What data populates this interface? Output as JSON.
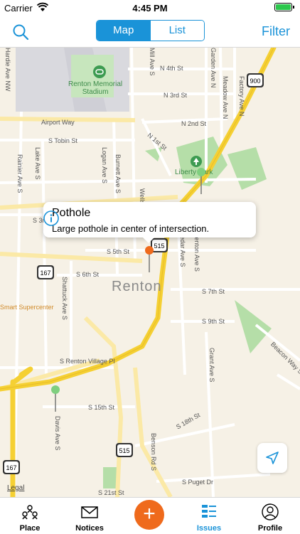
{
  "status_bar": {
    "carrier": "Carrier",
    "time": "4:45 PM"
  },
  "header": {
    "segment_map": "Map",
    "segment_list": "List",
    "filter_label": "Filter",
    "selected_segment": "Map"
  },
  "map": {
    "city_label": "Renton",
    "legal_label": "Legal",
    "park_labels": {
      "stadium": "Renton Memorial\nStadium",
      "liberty_park": "Liberty Park"
    },
    "street_labels": [
      "N 4th St",
      "N 3rd St",
      "N 2nd St",
      "N 1st St",
      "Airport Way",
      "S Tobin St",
      "S 5th St",
      "S 6th St",
      "S 7th St",
      "S 9th St",
      "S Renton Village Pl",
      "S 15th St",
      "S 18th St",
      "S Puget Dr",
      "S 21st St",
      "Rainier Ave S",
      "Lake Ave S",
      "Logan Ave S",
      "Burnett Ave S",
      "Shattuck Ave S",
      "Cedar Ave S",
      "Renton Ave S",
      "Grant Ave S",
      "Davis Ave S",
      "Benson Rd S",
      "Beacon Way S",
      "Factory Ave N",
      "Meadow Ave N",
      "Garden Ave N",
      "Hardie Ave NW",
      "Mill Ave S",
      "Wells Ave S",
      "Smart Supercenter",
      "S 3rd St"
    ],
    "route_shields": [
      "900",
      "167",
      "515",
      "167",
      "515",
      "167"
    ]
  },
  "callout": {
    "title": "Pothole",
    "description": "Large pothole in center of intersection."
  },
  "tabs": [
    {
      "label": "Place",
      "icon": "place-pins-icon"
    },
    {
      "label": "Notices",
      "icon": "envelope-icon"
    },
    {
      "label": "Add",
      "icon": "plus-icon"
    },
    {
      "label": "Issues",
      "icon": "issues-list-icon",
      "active": true
    },
    {
      "label": "Profile",
      "icon": "profile-icon"
    }
  ],
  "add_button_label": "+",
  "colors": {
    "accent": "#1a93d8",
    "add": "#ef6a1c",
    "highway": "#f5d033",
    "park": "#a9d9a0",
    "pin_green": "#7fcf7f",
    "pin_orange": "#ef6a1c"
  }
}
